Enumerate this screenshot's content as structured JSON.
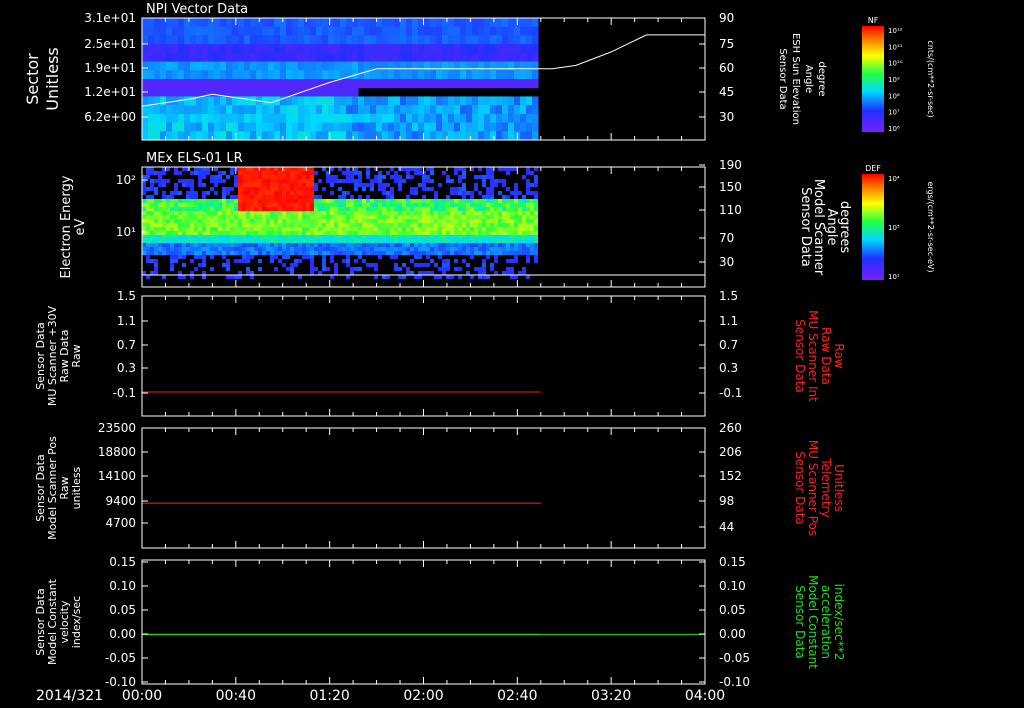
{
  "date_label": "2014/321",
  "time_ticks": [
    "00:00",
    "00:40",
    "01:20",
    "02:00",
    "02:40",
    "03:20",
    "04:00"
  ],
  "panels": [
    {
      "title": "NPI Vector Data",
      "left_label": [
        "Sector",
        "Unitless"
      ],
      "left_ticks": [
        "3.1e+01",
        "2.5e+01",
        "1.9e+01",
        "1.2e+01",
        "6.2e+00"
      ],
      "right_label": [
        "Sensor Data",
        "ESH Sun Elevation",
        "Angle",
        "degree"
      ],
      "right_ticks": [
        "90",
        "75",
        "60",
        "45",
        "30"
      ],
      "colorbar": {
        "label": "NF",
        "units": "cnts/(cm**2-sr-sec)",
        "ticks": [
          "10¹²",
          "10¹¹",
          "10¹⁰",
          "10⁹",
          "10⁸",
          "10⁷",
          "10⁶"
        ]
      }
    },
    {
      "title": "MEx ELS-01 LR",
      "left_label": [
        "Electron Energy",
        "eV"
      ],
      "left_ticks": [
        "10²",
        "10¹"
      ],
      "right_label": [
        "Sensor Data",
        "Model Scanner",
        "Angle",
        "degrees"
      ],
      "right_ticks": [
        "190",
        "150",
        "110",
        "70",
        "30"
      ],
      "colorbar": {
        "label": "DEF",
        "units": "ergs/(cm**2-sr-sec-eV)",
        "ticks": [
          "10⁴",
          "10³",
          "10¹"
        ]
      }
    },
    {
      "left_label": [
        "Sensor Data",
        "MU Scanner +30V",
        "Raw Data",
        "Raw"
      ],
      "left_ticks": [
        "1.5",
        "1.1",
        "0.7",
        "0.3",
        "-0.1"
      ],
      "right_label": [
        "Sensor Data",
        "MU Scanner Int",
        "Raw Data",
        "Raw"
      ],
      "right_ticks": [
        "1.5",
        "1.1",
        "0.7",
        "0.3",
        "-0.1"
      ]
    },
    {
      "left_label": [
        "Sensor Data",
        "Model Scanner Pos",
        "Raw",
        "unitless"
      ],
      "left_ticks": [
        "23500",
        "18800",
        "14100",
        "9400",
        "4700"
      ],
      "right_label": [
        "Sensor Data",
        "MU Scanner Pos",
        "Telemetry",
        "Unitless"
      ],
      "right_ticks": [
        "260",
        "206",
        "152",
        "98",
        "44"
      ]
    },
    {
      "left_label": [
        "Sensor Data",
        "Model Constant",
        "velocity",
        "index/sec"
      ],
      "left_ticks": [
        "0.15",
        "0.10",
        "0.05",
        "0.00",
        "-0.05",
        "-0.10"
      ],
      "right_label": [
        "Sensor Data",
        "Model Constant",
        "acceleration",
        "index/sec**2"
      ],
      "right_ticks": [
        "0.15",
        "0.10",
        "0.05",
        "0.00",
        "-0.05",
        "-0.10"
      ]
    }
  ],
  "colors": {
    "red_trace": "#ff2020",
    "green_trace": "#22dd22",
    "sun_line": "#ffffff"
  },
  "chart_data": [
    {
      "type": "heatmap",
      "title": "NPI Vector Data",
      "ylabel": "Sector Unitless",
      "y2label": "Sensor Data ESH Sun Elevation Angle degree",
      "x_range": [
        "00:00",
        "04:00"
      ],
      "y_range": [
        0,
        31
      ],
      "y2_range": [
        18,
        90
      ],
      "data_end": "02:48",
      "overlay_line": {
        "name": "ESH Sun Elevation Angle",
        "x_min": [
          0,
          20,
          30,
          45,
          55,
          80,
          100,
          160,
          175,
          185,
          200,
          215,
          240
        ],
        "y": [
          38,
          42,
          45,
          42,
          40,
          52,
          60,
          60,
          60,
          62,
          70,
          80,
          80
        ]
      }
    },
    {
      "type": "heatmap",
      "title": "MEx ELS-01 LR",
      "ylabel": "Electron Energy eV",
      "y2label": "Sensor Data Model Scanner Angle degrees",
      "x_range": [
        "00:00",
        "04:00"
      ],
      "y_scale": "log",
      "y_range": [
        1,
        150
      ],
      "y2_range": [
        10,
        190
      ],
      "data_end": "02:48",
      "overlay_value": 14
    },
    {
      "type": "line",
      "series": [
        {
          "name": "MU Scanner +30V Raw Data",
          "x_min": [
            0,
            170
          ],
          "y": [
            -0.1,
            -0.1
          ]
        }
      ],
      "x_range": [
        "00:00",
        "04:00"
      ],
      "ylim": [
        -0.5,
        1.5
      ],
      "y2lim": [
        -0.5,
        1.5
      ]
    },
    {
      "type": "line",
      "series": [
        {
          "name": "Model Scanner Pos",
          "x_min": [
            0,
            170
          ],
          "y": [
            8800,
            8800
          ]
        }
      ],
      "x_range": [
        "00:00",
        "04:00"
      ],
      "ylim": [
        0,
        23500
      ],
      "y2lim": [
        0,
        260
      ]
    },
    {
      "type": "line",
      "series": [
        {
          "name": "Model Constant velocity",
          "x_min": [
            0,
            170
          ],
          "y": [
            0,
            0
          ]
        }
      ],
      "x_range": [
        "00:00",
        "04:00"
      ],
      "ylim": [
        -0.1,
        0.15
      ],
      "y2lim": [
        -0.1,
        0.15
      ]
    }
  ]
}
